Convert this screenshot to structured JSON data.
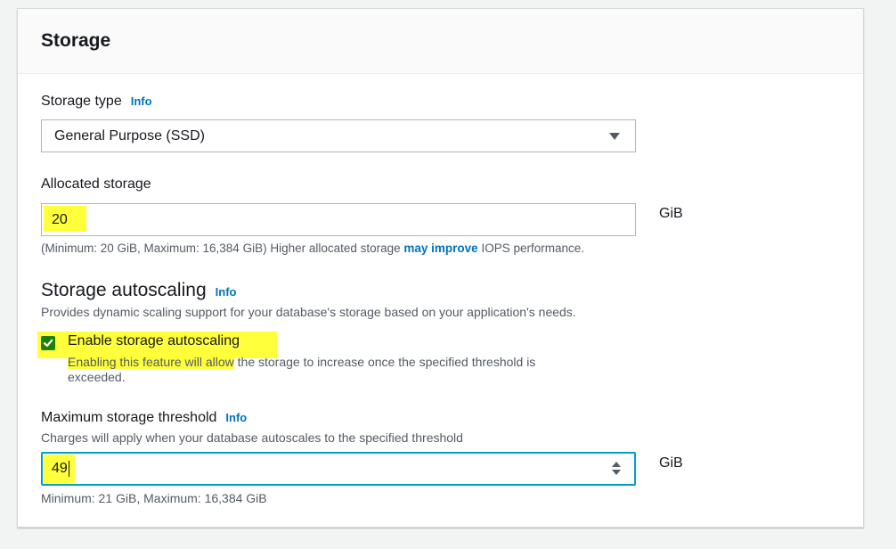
{
  "section": {
    "title": "Storage"
  },
  "storage_type": {
    "label": "Storage type",
    "info": "Info",
    "selected": "General Purpose (SSD)"
  },
  "allocated_storage": {
    "label": "Allocated storage",
    "value": "20",
    "unit": "GiB",
    "hint_prefix": "(Minimum: 20 GiB, Maximum: 16,384 GiB) Higher allocated storage ",
    "hint_link": "may improve",
    "hint_suffix": " IOPS performance."
  },
  "autoscaling": {
    "heading": "Storage autoscaling",
    "info": "Info",
    "description": "Provides dynamic scaling support for your database's storage based on your application's needs.",
    "checkbox_label": "Enable storage autoscaling",
    "checked": true,
    "checkbox_desc_line1_hl": "Enabling this feature will allow",
    "checkbox_desc_line1_rest": " the storage to increase once the specified threshold is",
    "checkbox_desc_line2": "exceeded."
  },
  "max_threshold": {
    "label": "Maximum storage threshold",
    "info": "Info",
    "description": "Charges will apply when your database autoscales to the specified threshold",
    "value": "49",
    "unit": "GiB",
    "hint": "Minimum: 21 GiB, Maximum: 16,384 GiB"
  },
  "colors": {
    "link": "#0073bb",
    "checkbox": "#1d8102",
    "focus_border": "#00a1c9",
    "highlight": "#ffff3b"
  }
}
